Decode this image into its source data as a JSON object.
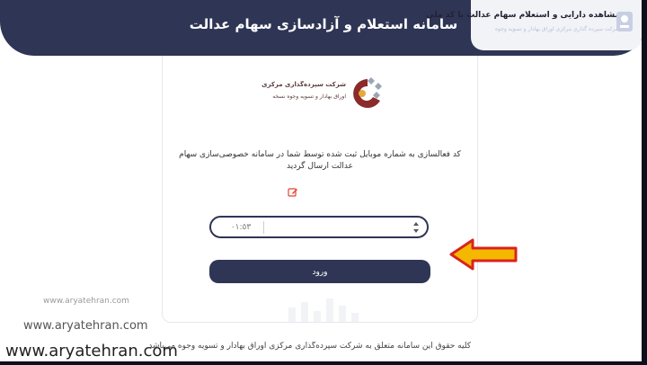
{
  "header": {
    "title": "سامانه استعلام و آزادسازی سهام عدالت"
  },
  "corner_panel": {
    "title": "مشاهده دارایی و استعلام سهام عدالت با کد ملی",
    "subtitle": "شرکت سپرده گذاری مرکزی اوراق بهادار و تسویه وجوه"
  },
  "organization": {
    "name": "شرکت سپرده‌گذاری مرکزی",
    "subtitle": "اوراق بهادار و تسویه وجوه نسخه"
  },
  "verification": {
    "message": "کد فعالسازی به شماره موبایل ثبت شده توسط شما در سامانه خصوصی‌سازی سهام عدالت ارسال گردید",
    "timer": "٠١:٥٣",
    "code_placeholder": "",
    "submit_label": "ورود"
  },
  "footer_note": "کلیه حقوق این سامانه متعلق به شرکت سپرده‌گذاری مرکزی اوراق بهادار و تسویه وجوه می‌باشد",
  "watermarks": {
    "small": "www.aryatehran.com",
    "medium": "www.aryatehran.com",
    "large": "www.aryatehran.com"
  },
  "colors": {
    "header": "#2f3555",
    "button": "#2f3555",
    "arrow": "#f5b800",
    "arrow_outline": "#d9231f"
  },
  "icons": {
    "edit": "edit-icon",
    "arrow": "arrow-left-icon"
  }
}
